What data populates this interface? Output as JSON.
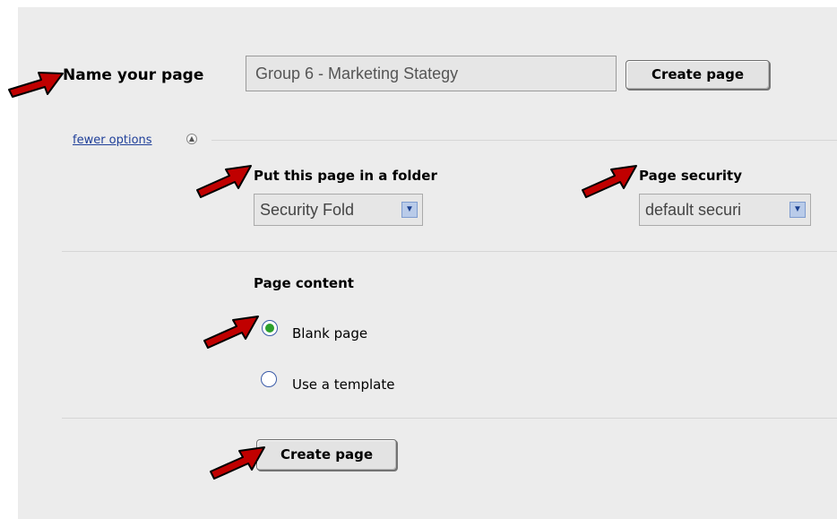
{
  "form": {
    "name_label": "Name your page",
    "name_value": "Group 6 - Marketing Stategy",
    "create_button_top": "Create page",
    "fewer_options": "fewer options",
    "folder_label": "Put this page in a folder",
    "folder_value": "Security Fold",
    "security_label": "Page security",
    "security_value": "default securi",
    "content_label": "Page content",
    "blank_label": "Blank page",
    "template_label": "Use a template",
    "create_button_bottom": "Create page"
  },
  "state": {
    "selected_content": "blank"
  },
  "colors": {
    "annotation_arrow": "#c00000",
    "radio_selected": "#2ca02c",
    "link": "#1f3f99"
  },
  "icons": {
    "dropdown": "chevron-down-icon",
    "collapse": "collapse-circle-icon",
    "annotation": "red-arrow-icon"
  }
}
